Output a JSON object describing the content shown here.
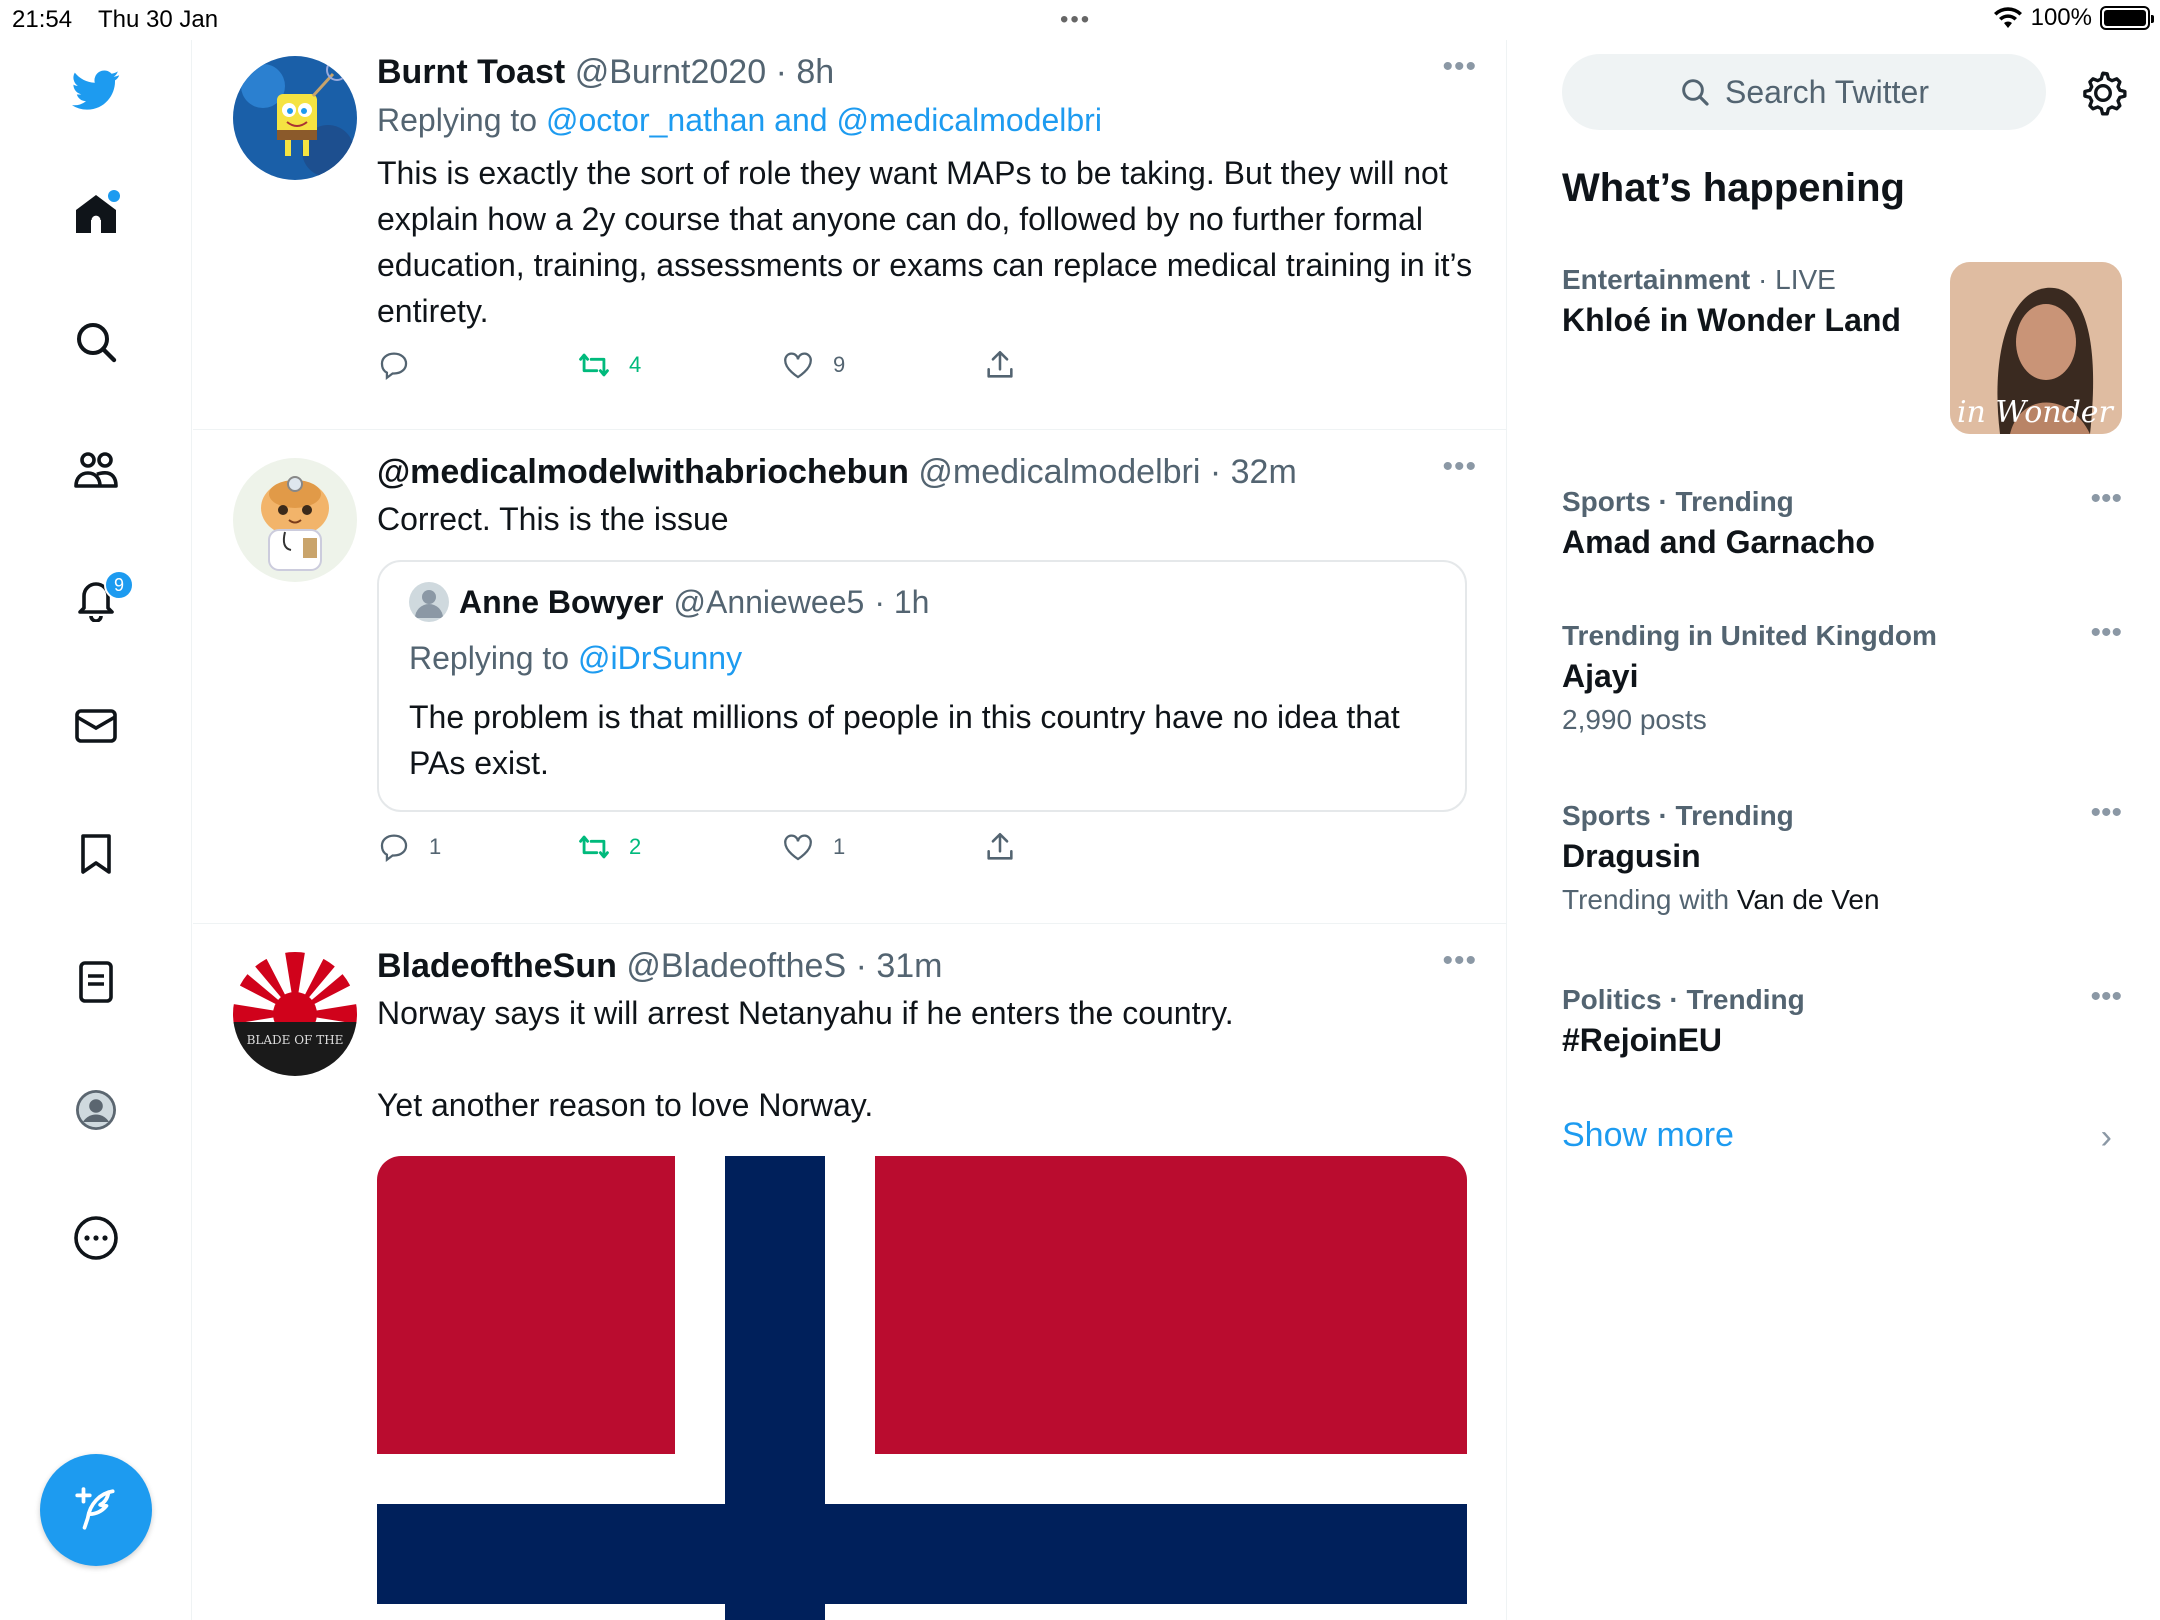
{
  "status_bar": {
    "time": "21:54",
    "date": "Thu 30 Jan",
    "dots": "•••",
    "battery": "100%"
  },
  "nav": {
    "notifications_badge": "9",
    "icons": [
      "twitter-logo",
      "home-icon",
      "search-icon",
      "communities-icon",
      "bell-icon",
      "mail-icon",
      "bookmark-icon",
      "lists-icon",
      "profile-icon",
      "more-icon",
      "compose-icon"
    ]
  },
  "colors": {
    "accent": "#1d9bf0",
    "retweet": "#00ba7c",
    "muted": "#536471",
    "norway_red": "#ba0c2f",
    "norway_blue": "#00205b"
  },
  "tweets": [
    {
      "name": "Burnt Toast",
      "handle": "@Burnt2020",
      "time": "· 8h",
      "replying_prefix": "Replying to",
      "replying_to": "@octor_nathan and @medicalmodelbri",
      "text": "This is exactly the sort of role they want MAPs to be taking. But they will not explain how a 2y course that anyone can do, followed by no further formal education, training, assessments or exams can replace medical training in it’s entirety.",
      "replies": "",
      "retweets": "4",
      "likes": "9"
    },
    {
      "name": "@medicalmodelwithabriochebun",
      "handle": "@medicalmodelbri",
      "time": "· 32m",
      "text": "Correct. This is the issue",
      "quote": {
        "name": "Anne Bowyer",
        "handle": "@Anniewee5",
        "time": "· 1h",
        "replying_prefix": "Replying to",
        "replying_to": "@iDrSunny",
        "text": "The problem is that millions of people in this country have no idea that PAs exist."
      },
      "replies": "1",
      "retweets": "2",
      "likes": "1"
    },
    {
      "name": "BladeoftheSun",
      "handle": "@BladeoftheS",
      "time": "· 31m",
      "text": "Norway says it will arrest Netanyahu if he enters the country.\n\nYet another reason to love Norway.",
      "avatar_text": "BLADE OF THE"
    }
  ],
  "right": {
    "search_placeholder": "Search Twitter",
    "section_title": "What’s happening",
    "trends": [
      {
        "category": "Entertainment",
        "category_suffix": "· LIVE",
        "title": "Khloé in Wonder Land",
        "image_text": "é in Wonder L"
      },
      {
        "category": "Sports · Trending",
        "title": "Amad and Garnacho"
      },
      {
        "category": "Trending in United Kingdom",
        "title": "Ajayi",
        "sub": "2,990 posts"
      },
      {
        "category": "Sports · Trending",
        "title": "Dragusin",
        "sub_prefix": "Trending with",
        "sub_value": "Van de Ven"
      },
      {
        "category": "Politics · Trending",
        "title": "#RejoinEU"
      }
    ],
    "show_more": "Show more",
    "more_dots": "•••",
    "chevron": "›"
  }
}
